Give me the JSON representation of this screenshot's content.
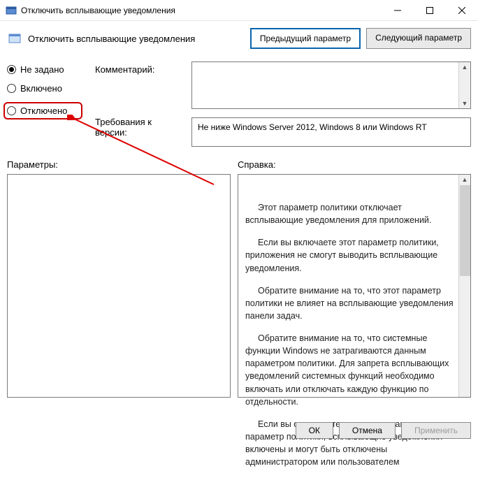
{
  "window": {
    "title": "Отключить всплывающие уведомления"
  },
  "header": {
    "title": "Отключить всплывающие уведомления",
    "prev_button": "Предыдущий параметр",
    "next_button": "Следующий параметр"
  },
  "radios": {
    "not_configured": "Не задано",
    "enabled": "Включено",
    "disabled": "Отключено",
    "selected": "not_configured"
  },
  "labels": {
    "comment": "Комментарий:",
    "requirements": "Требования к версии:",
    "parameters": "Параметры:",
    "help": "Справка:"
  },
  "fields": {
    "comment_value": "",
    "requirements_value": "Не ниже Windows Server 2012, Windows 8 или Windows RT"
  },
  "help_text": {
    "p1": "Этот параметр политики отключает всплывающие уведомления для приложений.",
    "p2": "Если вы включаете этот параметр политики, приложения не смогут выводить всплывающие уведомления.",
    "p3": "Обратите внимание на то, что этот параметр политики не влияет на всплывающие уведомления панели задач.",
    "p4": "Обратите внимание на то, что системные функции Windows не затрагиваются данным параметром политики. Для запрета всплывающих уведомлений системных функций необходимо включать или отключать каждую функцию по отдельности.",
    "p5": "Если вы отключаете или не настраиваете этот параметр политики, всплывающие уведомления включены и могут быть отключены администратором или пользователем"
  },
  "footer": {
    "ok": "ОК",
    "cancel": "Отмена",
    "apply": "Применить"
  }
}
